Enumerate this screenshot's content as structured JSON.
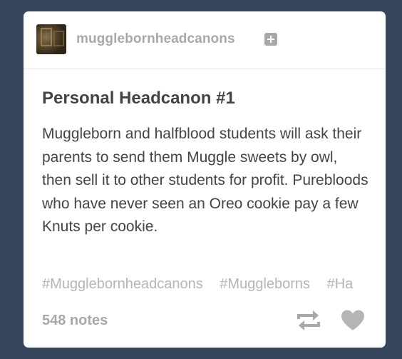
{
  "post": {
    "blog_name": "mugglebornheadcanons",
    "follow_icon": "plus-square-icon",
    "title": "Personal Headcanon #1",
    "body": "Muggleborn and halfblood students will ask their parents to send them Muggle sweets by owl, then sell it to other students for profit. Purebloods who have never seen an Oreo cookie pay a few Knuts per cookie.",
    "tags": [
      "#Mugglebornheadcanons",
      "#Muggleborns",
      "#Ha"
    ],
    "notes": "548 notes",
    "reblog_icon": "reblog-icon",
    "like_icon": "heart-icon"
  },
  "colors": {
    "background": "#36465d",
    "card": "#ffffff",
    "text": "#444444",
    "muted": "#a8a8a8",
    "tag": "#b5b5b5"
  }
}
